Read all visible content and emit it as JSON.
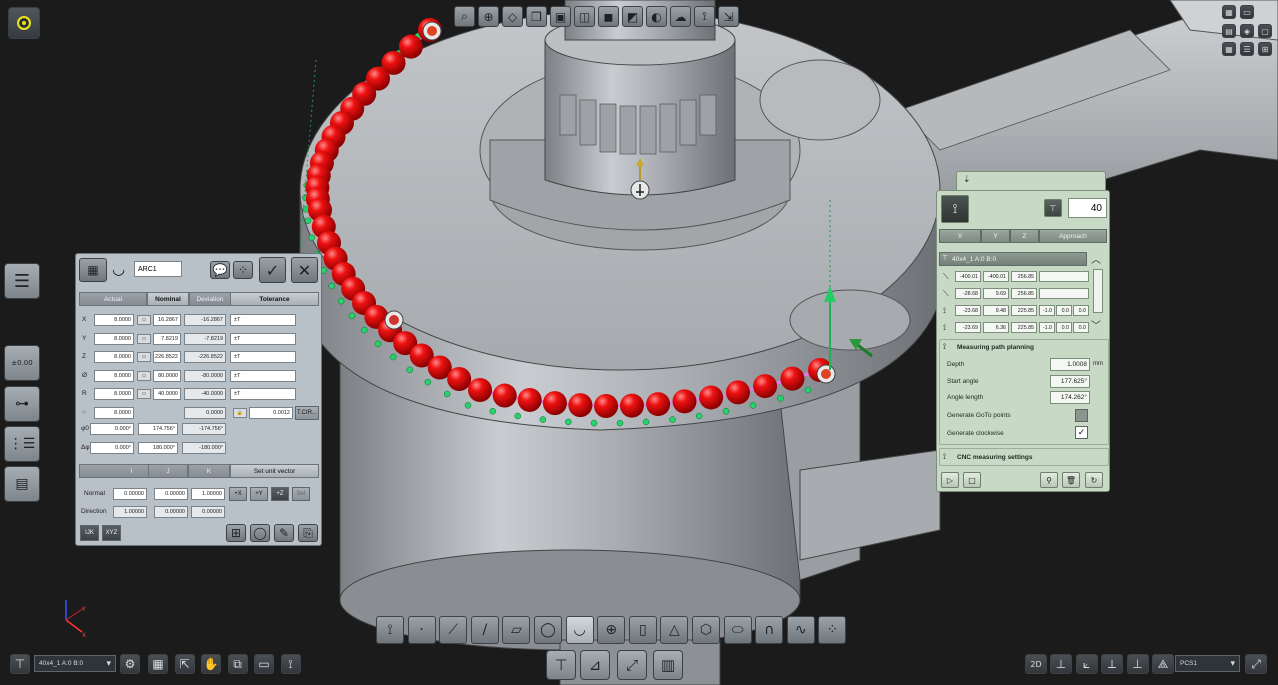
{
  "toolbar_top": {
    "icons": [
      "zoom-fit-icon",
      "zoom-icon",
      "view-front-icon",
      "view-cube-icon",
      "view-iso-icon",
      "view-hide-icon",
      "view-solid-icon",
      "view-shaded-icon",
      "view-section-icon",
      "view-cloud-icon",
      "view-ruler-icon",
      "view-align-icon"
    ]
  },
  "arc_dialog": {
    "element_name": "ARC1",
    "columns": {
      "actual": "Actual",
      "nominal": "Nominal",
      "deviation": "Deviation",
      "tolerance": "Tolerance"
    },
    "rows": [
      {
        "label": "X",
        "actual": "8.0000",
        "nominal": "16.2867",
        "deviation": "-16.2867",
        "tolerance": "±T"
      },
      {
        "label": "Y",
        "actual": "8.0000",
        "nominal": "7.8219",
        "deviation": "-7.8219",
        "tolerance": "±T"
      },
      {
        "label": "Z",
        "actual": "8.0000",
        "nominal": "226.8522",
        "deviation": "-226.8522",
        "tolerance": "±T"
      },
      {
        "label": "Ø",
        "actual": "8.0000",
        "nominal": "80.0000",
        "deviation": "-80.0000",
        "tolerance": "±T"
      },
      {
        "label": "R",
        "actual": "8.0000",
        "nominal": "40.0000",
        "deviation": "-40.0000",
        "tolerance": "±T"
      },
      {
        "label": "○",
        "actual": "8.0000",
        "nominal": "",
        "deviation": "0.0000",
        "tolerance": "0.0012"
      }
    ],
    "form_button": "T.CIR...",
    "phi0": {
      "label": "φ0",
      "actual": "0.000°",
      "nominal": "174.756°",
      "deviation": "-174.756°"
    },
    "dphi": {
      "label": "Δφ",
      "actual": "0.000°",
      "nominal": "180.000°",
      "deviation": "-180.000°"
    },
    "vector_header": {
      "i": "I",
      "j": "J",
      "k": "K",
      "set_unit": "Set unit vector"
    },
    "normal": {
      "label": "Normal",
      "i": "0.00000",
      "j": "0.00000",
      "k": "1.00000"
    },
    "direction": {
      "label": "Direction",
      "i": "1.00000",
      "j": "0.00000",
      "k": "0.00000"
    },
    "axis_buttons": [
      "+X",
      "+Y",
      "+Z",
      "Set"
    ],
    "mode_buttons": [
      "IJK",
      "XYZ"
    ]
  },
  "cnc_panel": {
    "count": "40",
    "tabs": {
      "x": "X",
      "y": "Y",
      "z": "Z",
      "approach": "Approach"
    },
    "probe": "40x4_1 A:0 B:0",
    "points": [
      {
        "x": "-400.01",
        "y": "-400.01",
        "z": "256.85",
        "a": "",
        "b": "",
        "c": ""
      },
      {
        "x": "-28.68",
        "y": "9.69",
        "z": "256.85",
        "a": "",
        "b": "",
        "c": ""
      },
      {
        "x": "-23.68",
        "y": "9.48",
        "z": "225.85",
        "a": "-1.0",
        "b": "0.0",
        "c": "0.0"
      },
      {
        "x": "-23.69",
        "y": "6.36",
        "z": "225.85",
        "a": "-1.0",
        "b": "0.0",
        "c": "0.0"
      }
    ],
    "path_planning": {
      "title": "Measuring path planning",
      "depth_label": "Depth",
      "depth": "1.0008",
      "depth_unit": "mm",
      "start_label": "Start angle",
      "start": "177.625°",
      "length_label": "Angle length",
      "length": "174.262°",
      "goto_label": "Generate GoTo points",
      "goto_checked": false,
      "clockwise_label": "Generate clockwise",
      "clockwise_checked": true
    },
    "cnc_settings": "CNC measuring settings"
  },
  "bottom_bar": {
    "probe_select": "40x4_1 A:0 B:0",
    "view_mode": "2D",
    "coord_system": "PCS1"
  }
}
